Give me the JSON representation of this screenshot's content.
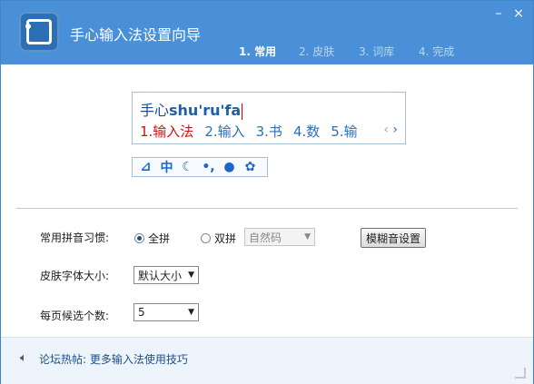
{
  "window": {
    "title": "手心输入法设置向导",
    "min_symbol": "–",
    "close_symbol": "×"
  },
  "steps": [
    {
      "label": "1. 常用",
      "active": true
    },
    {
      "label": "2. 皮肤",
      "active": false
    },
    {
      "label": "3. 词库",
      "active": false
    },
    {
      "label": "4. 完成",
      "active": false
    }
  ],
  "preview": {
    "typed_text": "手心",
    "pinyin": "shu'ru'fa",
    "candidates": [
      "1.输入法",
      "2.输入",
      "3.书",
      "4.数",
      "5.输"
    ],
    "prev_arrow": "‹",
    "next_arrow": "›",
    "toolbar_icons": [
      "logo-icon",
      "chinese-mode-icon",
      "moon-icon",
      "punctuation-icon",
      "user-icon",
      "gear-icon"
    ],
    "toolbar_glyphs": [
      "⊿",
      "中",
      "☾",
      "•,",
      "●",
      "✿"
    ]
  },
  "settings": {
    "pinyin_label": "常用拼音习惯:",
    "full_pinyin": "全拼",
    "double_pinyin": "双拼",
    "double_scheme": "自然码",
    "fuzzy_button": "模糊音设置",
    "skin_font_label": "皮肤字体大小:",
    "skin_font_value": "默认大小",
    "candidates_label": "每页候选个数:",
    "candidates_value": "5"
  },
  "footer": {
    "forum_label": "论坛热帖:",
    "forum_link": "更多输入法使用技巧"
  },
  "colors": {
    "header": "#4a90d8",
    "candidate_first": "#d21010",
    "candidate": "#2c6ebd"
  }
}
